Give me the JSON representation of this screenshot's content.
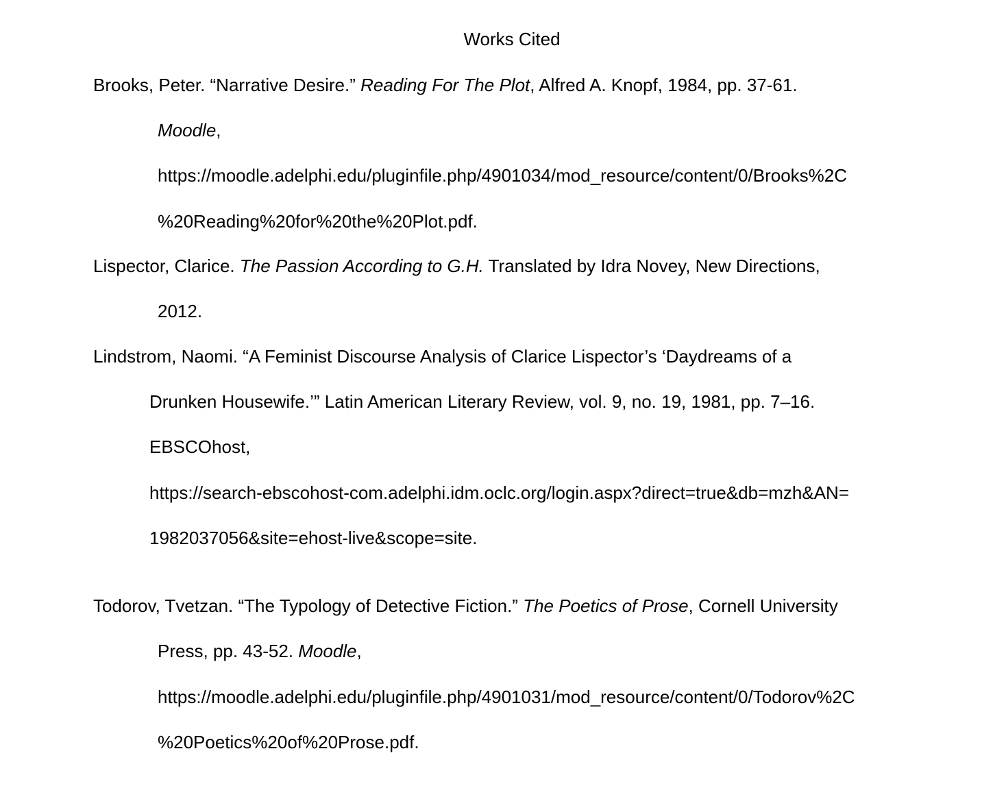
{
  "title": "Works Cited",
  "citations": [
    {
      "lines": [
        {
          "a": "Brooks, Peter. “Narrative Desire.” ",
          "i": "Reading For The Plot",
          "b": ", Alfred A. Knopf, 1984, pp. 37-61."
        },
        {
          "a": "",
          "i": "Moodle",
          "b": ","
        },
        {
          "a": "https://moodle.adelphi.edu/pluginfile.php/4901034/mod_resource/content/0/Brooks%2C",
          "i": "",
          "b": ""
        },
        {
          "a": "%20Reading%20for%20the%20Plot.pdf.",
          "i": "",
          "b": ""
        }
      ]
    },
    {
      "lines": [
        {
          "a": "Lispector, Clarice. ",
          "i": "The Passion According to G.H.",
          "b": " Translated by Idra Novey, New Directions,"
        },
        {
          "a": "2012.",
          "i": "",
          "b": ""
        }
      ]
    },
    {
      "lines": [
        {
          "a": "Lindstrom, Naomi. “A Feminist Discourse Analysis of Clarice Lispector’s ‘Daydreams of a",
          "i": "",
          "b": ""
        },
        {
          "a": "Drunken Housewife.’” Latin American Literary Review, vol. 9, no. 19, 1981, pp. 7–16.",
          "i": "",
          "b": ""
        },
        {
          "a": "EBSCOhost,",
          "i": "",
          "b": ""
        },
        {
          "a": "https://search-ebscohost-com.adelphi.idm.oclc.org/login.aspx?direct=true&db=mzh&AN=",
          "i": "",
          "b": ""
        },
        {
          "a": "1982037056&site=ehost-live&scope=site.",
          "i": "",
          "b": ""
        }
      ]
    },
    {
      "lines": [
        {
          "a": "Todorov, Tvetzan. “The Typology of Detective Fiction.” ",
          "i": "The Poetics of Prose",
          "b": ", Cornell University"
        },
        {
          "a": "Press, pp. 43-52. ",
          "i": "Moodle",
          "b": ","
        },
        {
          "a": "https://moodle.adelphi.edu/pluginfile.php/4901031/mod_resource/content/0/Todorov%2C",
          "i": "",
          "b": ""
        },
        {
          "a": "%20Poetics%20of%20Prose.pdf.",
          "i": "",
          "b": ""
        }
      ]
    }
  ]
}
